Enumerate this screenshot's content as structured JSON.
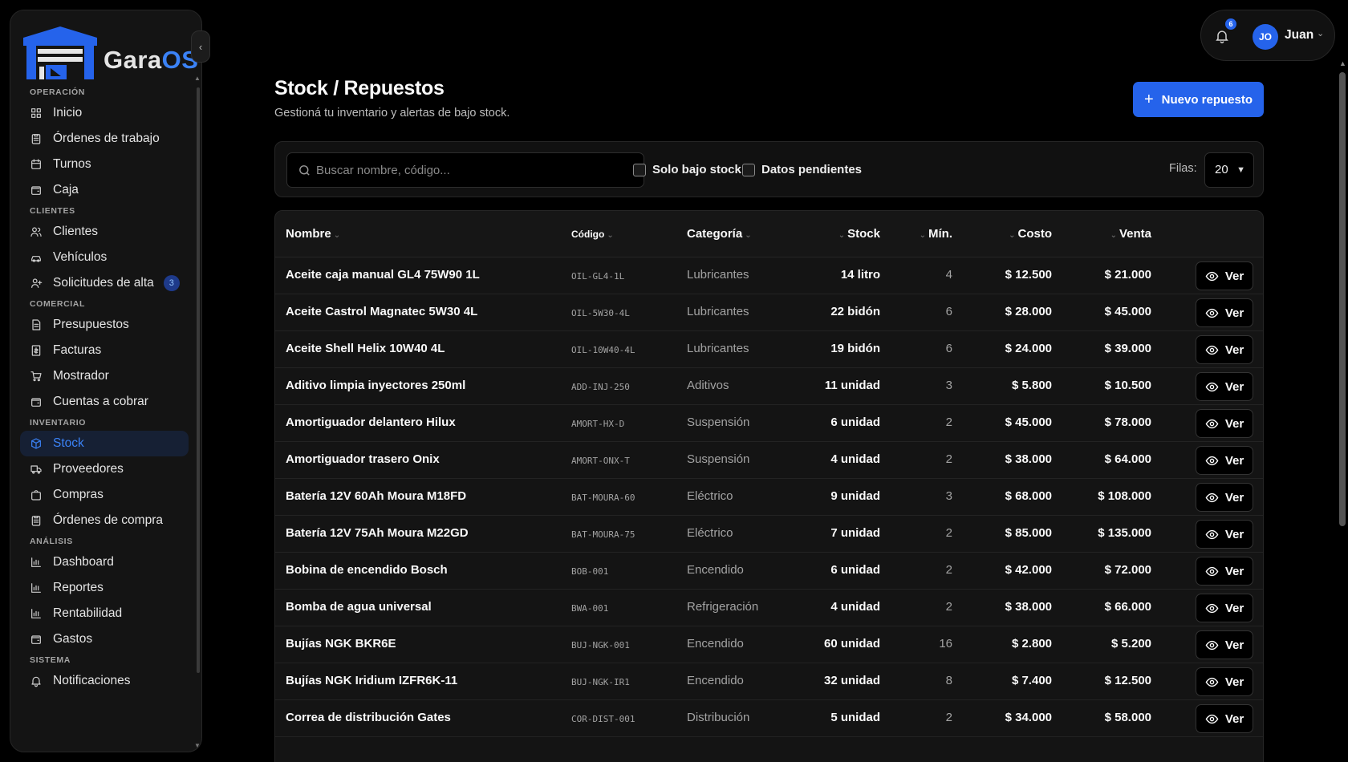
{
  "brand": {
    "logo_text_main": "Gara",
    "logo_text_accent": "OS",
    "accent": "#2563eb"
  },
  "sidebar": {
    "sections": [
      {
        "label": "OPERACIÓN",
        "items": [
          {
            "label": "Inicio",
            "icon": "grid-icon"
          },
          {
            "label": "Órdenes de trabajo",
            "icon": "clipboard-icon"
          },
          {
            "label": "Turnos",
            "icon": "calendar-icon"
          },
          {
            "label": "Caja",
            "icon": "wallet-icon"
          }
        ]
      },
      {
        "label": "CLIENTES",
        "items": [
          {
            "label": "Clientes",
            "icon": "users-icon"
          },
          {
            "label": "Vehículos",
            "icon": "car-icon"
          },
          {
            "label": "Solicitudes de alta",
            "icon": "user-plus-icon",
            "count": "3"
          }
        ]
      },
      {
        "label": "COMERCIAL",
        "items": [
          {
            "label": "Presupuestos",
            "icon": "file-text-icon"
          },
          {
            "label": "Facturas",
            "icon": "receipt-icon"
          },
          {
            "label": "Mostrador",
            "icon": "cart-icon"
          },
          {
            "label": "Cuentas a cobrar",
            "icon": "wallet-icon"
          }
        ]
      },
      {
        "label": "INVENTARIO",
        "items": [
          {
            "label": "Stock",
            "icon": "box-icon",
            "active": true
          },
          {
            "label": "Proveedores",
            "icon": "truck-icon"
          },
          {
            "label": "Compras",
            "icon": "shopping-bag-icon"
          },
          {
            "label": "Órdenes de compra",
            "icon": "clipboard-icon"
          }
        ]
      },
      {
        "label": "ANÁLISIS",
        "items": [
          {
            "label": "Dashboard",
            "icon": "bar-chart-icon"
          },
          {
            "label": "Reportes",
            "icon": "bar-chart-icon"
          },
          {
            "label": "Rentabilidad",
            "icon": "bar-chart-icon"
          },
          {
            "label": "Gastos",
            "icon": "wallet-icon"
          }
        ]
      },
      {
        "label": "SISTEMA",
        "items": [
          {
            "label": "Notificaciones",
            "icon": "bell-icon"
          }
        ]
      }
    ]
  },
  "header": {
    "notification_count": "6",
    "user_initials": "JO",
    "user_name": "Juan"
  },
  "page": {
    "title": "Stock / Repuestos",
    "subtitle": "Gestioná tu inventario y alertas de bajo stock.",
    "new_button": "Nuevo repuesto"
  },
  "filters": {
    "search_placeholder": "Buscar nombre, código...",
    "low_stock_label": "Solo bajo stock",
    "pending_label": "Datos pendientes",
    "rows_label": "Filas:",
    "rows_value": "20"
  },
  "table": {
    "headers": {
      "name": "Nombre",
      "code": "Código",
      "category": "Categoría",
      "stock": "Stock",
      "min": "Mín.",
      "cost": "Costo",
      "sale": "Venta"
    },
    "view_label": "Ver",
    "rows": [
      {
        "name": "Aceite caja manual GL4 75W90 1L",
        "code": "OIL-GL4-1L",
        "category": "Lubricantes",
        "stock": "14 litro",
        "min": "4",
        "cost": "$ 12.500",
        "sale": "$ 21.000"
      },
      {
        "name": "Aceite Castrol Magnatec 5W30 4L",
        "code": "OIL-5W30-4L",
        "category": "Lubricantes",
        "stock": "22 bidón",
        "min": "6",
        "cost": "$ 28.000",
        "sale": "$ 45.000"
      },
      {
        "name": "Aceite Shell Helix 10W40 4L",
        "code": "OIL-10W40-4L",
        "category": "Lubricantes",
        "stock": "19 bidón",
        "min": "6",
        "cost": "$ 24.000",
        "sale": "$ 39.000"
      },
      {
        "name": "Aditivo limpia inyectores 250ml",
        "code": "ADD-INJ-250",
        "category": "Aditivos",
        "stock": "11 unidad",
        "min": "3",
        "cost": "$ 5.800",
        "sale": "$ 10.500"
      },
      {
        "name": "Amortiguador delantero Hilux",
        "code": "AMORT-HX-D",
        "category": "Suspensión",
        "stock": "6 unidad",
        "min": "2",
        "cost": "$ 45.000",
        "sale": "$ 78.000"
      },
      {
        "name": "Amortiguador trasero Onix",
        "code": "AMORT-ONX-T",
        "category": "Suspensión",
        "stock": "4 unidad",
        "min": "2",
        "cost": "$ 38.000",
        "sale": "$ 64.000"
      },
      {
        "name": "Batería 12V 60Ah Moura M18FD",
        "code": "BAT-MOURA-60",
        "category": "Eléctrico",
        "stock": "9 unidad",
        "min": "3",
        "cost": "$ 68.000",
        "sale": "$ 108.000"
      },
      {
        "name": "Batería 12V 75Ah Moura M22GD",
        "code": "BAT-MOURA-75",
        "category": "Eléctrico",
        "stock": "7 unidad",
        "min": "2",
        "cost": "$ 85.000",
        "sale": "$ 135.000"
      },
      {
        "name": "Bobina de encendido Bosch",
        "code": "BOB-001",
        "category": "Encendido",
        "stock": "6 unidad",
        "min": "2",
        "cost": "$ 42.000",
        "sale": "$ 72.000"
      },
      {
        "name": "Bomba de agua universal",
        "code": "BWA-001",
        "category": "Refrigeración",
        "stock": "4 unidad",
        "min": "2",
        "cost": "$ 38.000",
        "sale": "$ 66.000"
      },
      {
        "name": "Bujías NGK BKR6E",
        "code": "BUJ-NGK-001",
        "category": "Encendido",
        "stock": "60 unidad",
        "min": "16",
        "cost": "$ 2.800",
        "sale": "$ 5.200"
      },
      {
        "name": "Bujías NGK Iridium IZFR6K-11",
        "code": "BUJ-NGK-IR1",
        "category": "Encendido",
        "stock": "32 unidad",
        "min": "8",
        "cost": "$ 7.400",
        "sale": "$ 12.500"
      },
      {
        "name": "Correa de distribución Gates",
        "code": "COR-DIST-001",
        "category": "Distribución",
        "stock": "5 unidad",
        "min": "2",
        "cost": "$ 34.000",
        "sale": "$ 58.000"
      }
    ]
  }
}
